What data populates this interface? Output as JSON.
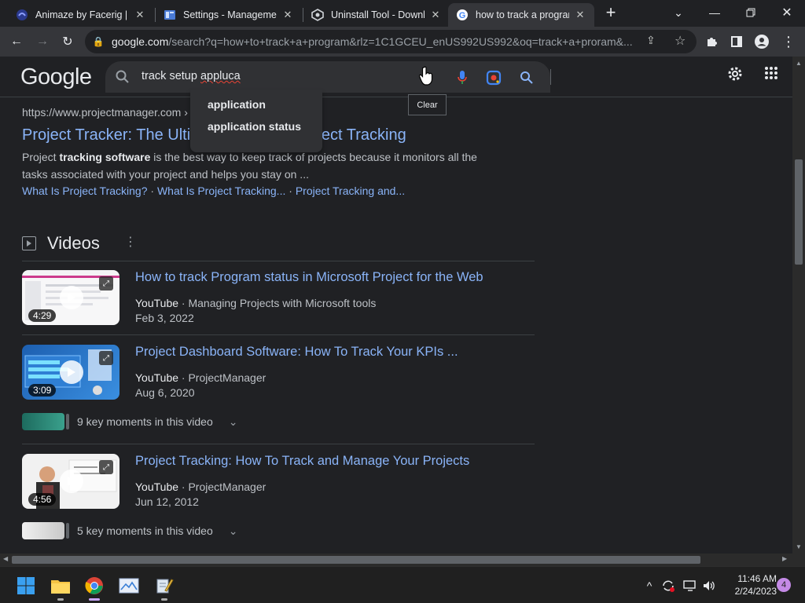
{
  "browser": {
    "tabs": [
      {
        "title": "Animaze by Facerig | Ci",
        "icon": "animaze-icon",
        "active": false
      },
      {
        "title": "Settings - Management",
        "icon": "settings-doc-icon",
        "active": false
      },
      {
        "title": "Uninstall Tool - Downlo",
        "icon": "uninstall-icon",
        "active": false
      },
      {
        "title": "how to track a program",
        "icon": "google-icon",
        "active": true
      }
    ],
    "new_tab_label": "+",
    "address": {
      "domain": "google.com",
      "path": "/search?q=how+to+track+a+program&rlz=1C1GCEU_enUS992US992&oq=track+a+proram&..."
    }
  },
  "google": {
    "logo_text": "Google",
    "search_query_plain": "track setup ",
    "search_query_typo": "appluca",
    "clear_tooltip": "Clear",
    "suggestions": [
      "application",
      "application status"
    ]
  },
  "result": {
    "cite": "https://www.projectmanager.com ›",
    "title": "Project Tracker: The Ultimate Guide to Project Tracking",
    "snippet_pre": "Project ",
    "snippet_bold": "tracking software",
    "snippet_post": " is the best way to keep track of projects because it monitors all the tasks associated with your project and helps you stay on ...",
    "sitelinks": [
      "What Is Project Tracking?",
      "What Is Project Tracking...",
      "Project Tracking and..."
    ],
    "sitelink_sep": " · "
  },
  "videos": {
    "heading": "Videos",
    "items": [
      {
        "title": "How to track Program status in Microsoft Project for the Web",
        "source": "YouTube",
        "channel": "Managing Projects with Microsoft tools",
        "date": "Feb 3, 2022",
        "duration": "4:29",
        "key_moments": ""
      },
      {
        "title": "Project Dashboard Software: How To Track Your KPIs ...",
        "source": "YouTube",
        "channel": "ProjectManager",
        "date": "Aug 6, 2020",
        "duration": "3:09",
        "key_moments": "9 key moments in this video"
      },
      {
        "title": "Project Tracking: How To Track and Manage Your Projects",
        "source": "YouTube",
        "channel": "ProjectManager",
        "date": "Jun 12, 2012",
        "duration": "4:56",
        "key_moments": "5 key moments in this video"
      }
    ]
  },
  "taskbar": {
    "time": "11:46 AM",
    "date": "2/24/2023",
    "notifications": "4"
  },
  "colors": {
    "link": "#8ab4f8",
    "background": "#202124",
    "text": "#bdc1c6",
    "accent_notif": "#c48ae6"
  }
}
